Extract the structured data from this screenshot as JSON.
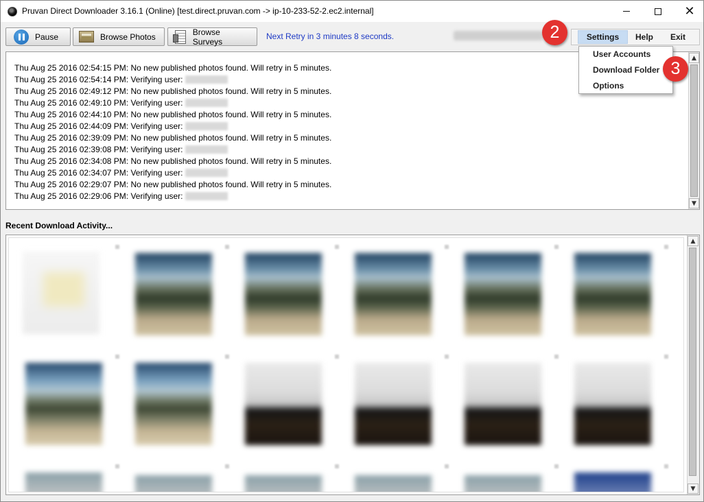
{
  "window": {
    "title": "Pruvan Direct Downloader 3.16.1 (Online)  [test.direct.pruvan.com -> ip-10-233-52-2.ec2.internal]",
    "controls": {
      "minimize": "—",
      "maximize": "☐",
      "close": "✕"
    }
  },
  "toolbar": {
    "pause_label": "Pause",
    "browse_photos_label": "Browse Photos",
    "browse_surveys_label": "Browse Surveys",
    "retry_status": "Next Retry in 3 minutes 8 seconds."
  },
  "menu": {
    "settings": "Settings",
    "help": "Help",
    "exit": "Exit",
    "settings_items": [
      "User Accounts",
      "Download Folder",
      "Options"
    ]
  },
  "badges": {
    "step2": "2",
    "step3": "3"
  },
  "log": {
    "lines": [
      "Thu Aug 25 2016 02:54:15 PM: No new published photos found.  Will retry in 5 minutes.",
      "Thu Aug 25 2016 02:54:14 PM: Verifying user:",
      "Thu Aug 25 2016 02:49:12 PM: No new published photos found.  Will retry in 5 minutes.",
      "Thu Aug 25 2016 02:49:10 PM: Verifying user:",
      "Thu Aug 25 2016 02:44:10 PM: No new published photos found.  Will retry in 5 minutes.",
      "Thu Aug 25 2016 02:44:09 PM: Verifying user:",
      "Thu Aug 25 2016 02:39:09 PM: No new published photos found.  Will retry in 5 minutes.",
      "Thu Aug 25 2016 02:39:08 PM: Verifying user:",
      "Thu Aug 25 2016 02:34:08 PM: No new published photos found.  Will retry in 5 minutes.",
      "Thu Aug 25 2016 02:34:07 PM: Verifying user:",
      "Thu Aug 25 2016 02:29:07 PM: No new published photos found.  Will retry in 5 minutes.",
      "Thu Aug 25 2016 02:29:06 PM: Verifying user:"
    ]
  },
  "activity": {
    "label": "Recent Download Activity..."
  },
  "scroll": {
    "up": "▲",
    "down": "▼"
  }
}
